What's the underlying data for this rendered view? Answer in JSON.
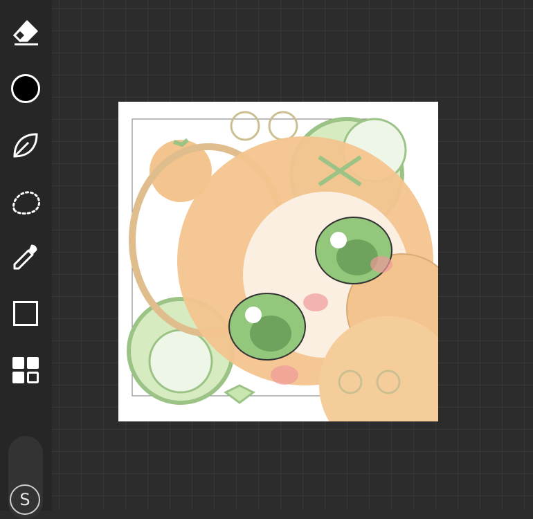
{
  "toolbar": {
    "tools": [
      {
        "name": "eraser",
        "icon": "eraser-icon"
      },
      {
        "name": "color",
        "icon": "color-swatch-icon",
        "color": "#000000"
      },
      {
        "name": "brush",
        "icon": "leaf-brush-icon"
      },
      {
        "name": "lasso",
        "icon": "lasso-icon"
      },
      {
        "name": "eyedropper",
        "icon": "eyedropper-icon"
      },
      {
        "name": "shape",
        "icon": "square-icon"
      },
      {
        "name": "layers",
        "icon": "layers-grid-icon"
      }
    ],
    "s_button_label": "S"
  },
  "colors": {
    "accent_orange": "#f3c48e",
    "accent_green": "#a9d48f"
  }
}
